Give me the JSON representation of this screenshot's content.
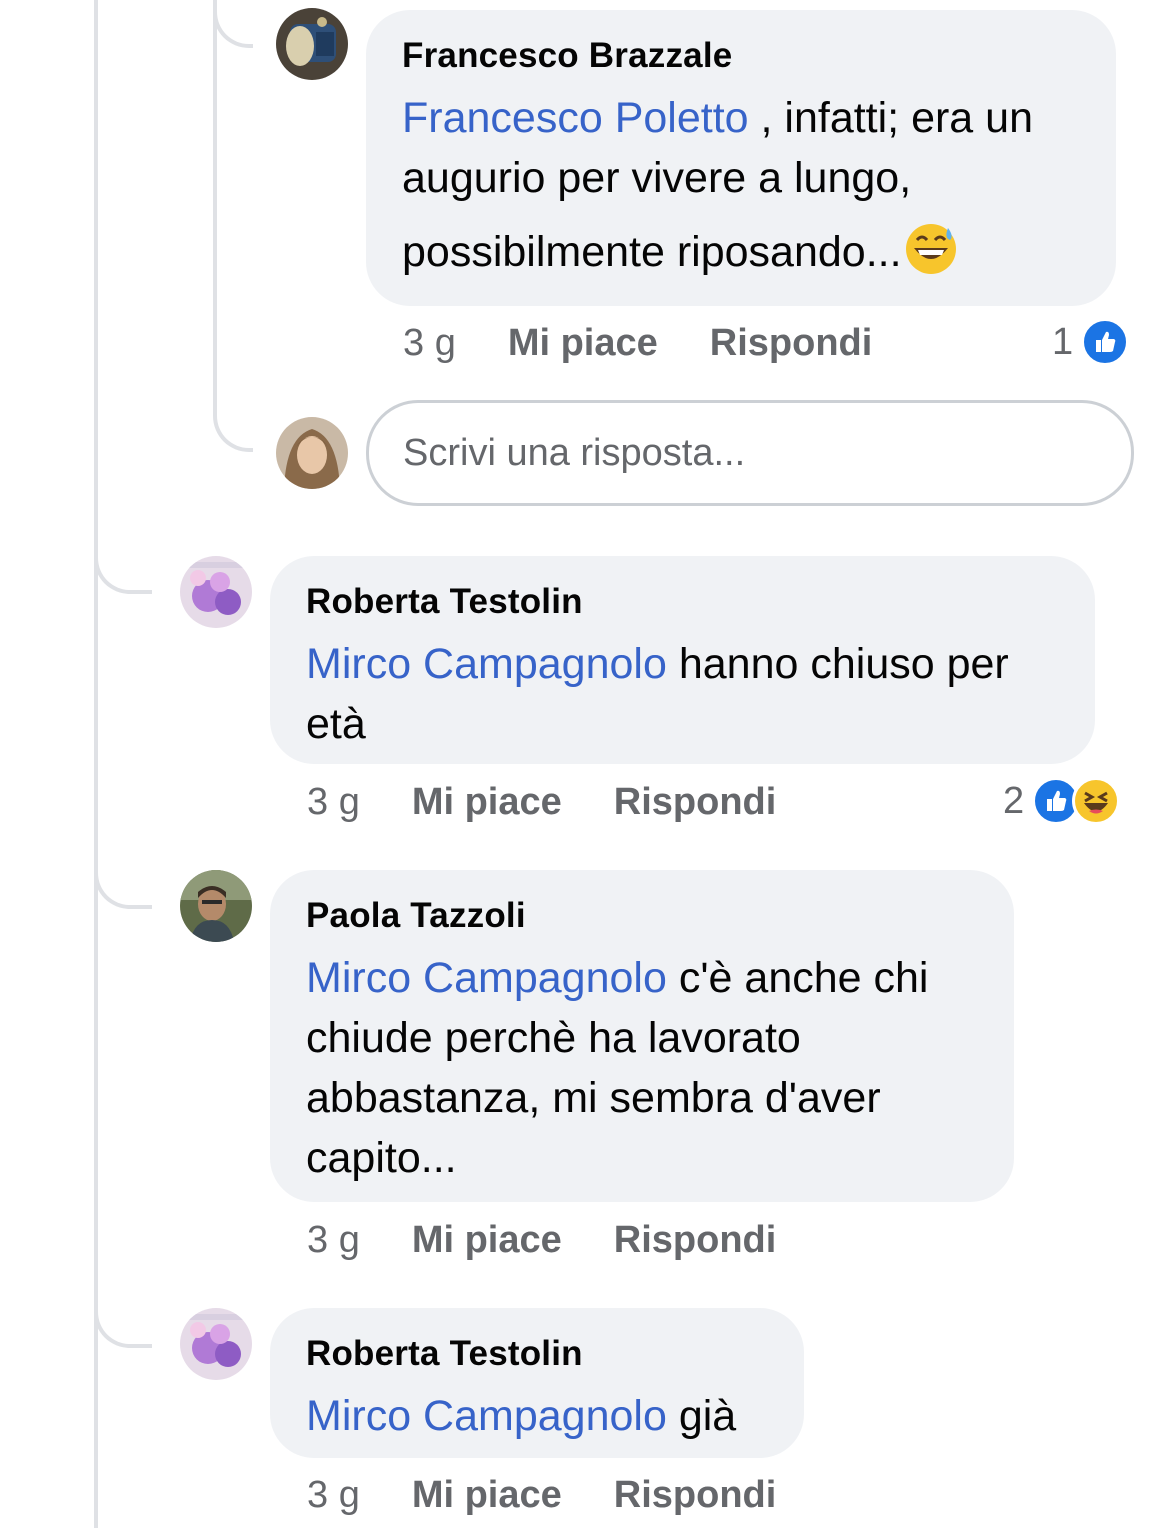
{
  "comments": [
    {
      "author": "Francesco Brazzale",
      "mention": "Francesco Poletto",
      "text_line1": " , infatti; era un",
      "text_line2": "augurio per vivere a lungo,",
      "text_line3": "possibilmente riposando...",
      "emoji": "grinning-face-with-sweat",
      "time": "3 g",
      "like_label": "Mi piace",
      "reply_label": "Rispondi",
      "reaction_count": "1",
      "reactions": [
        "like"
      ]
    },
    {
      "author": "Roberta Testolin",
      "mention": "Mirco Campagnolo",
      "text_line1": " hanno chiuso per",
      "text_line2": "età",
      "time": "3 g",
      "like_label": "Mi piace",
      "reply_label": "Rispondi",
      "reaction_count": "2",
      "reactions": [
        "like",
        "haha"
      ]
    },
    {
      "author": "Paola Tazzoli",
      "mention": "Mirco Campagnolo",
      "text_line1": " c'è anche chi",
      "text_line2": "chiude perchè ha lavorato",
      "text_line3": "abbastanza, mi sembra d'aver",
      "text_line4": "capito...",
      "time": "3 g",
      "like_label": "Mi piace",
      "reply_label": "Rispondi"
    },
    {
      "author": "Roberta Testolin",
      "mention": "Mirco Campagnolo",
      "text_line1": " già",
      "time": "3 g",
      "like_label": "Mi piace",
      "reply_label": "Rispondi"
    }
  ],
  "reply_box": {
    "placeholder": "Scrivi una risposta..."
  },
  "colors": {
    "mention": "#3763c9",
    "bubble": "#f0f2f5",
    "like_blue": "#1b74e4",
    "haha_yellow": "#f7c52c",
    "thread_line": "#dfe1e5"
  }
}
